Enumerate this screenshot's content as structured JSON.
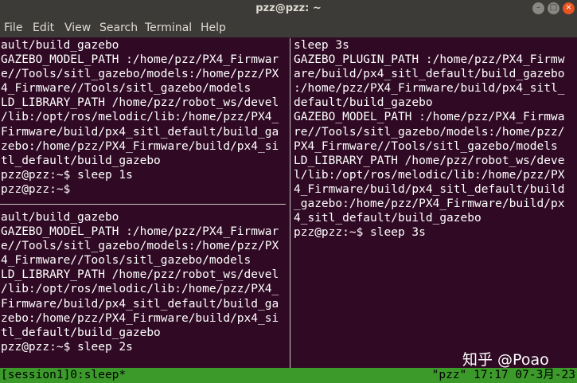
{
  "window": {
    "title": "pzz@pzz: ~"
  },
  "menu": [
    "File",
    "Edit",
    "View",
    "Search",
    "Terminal",
    "Help"
  ],
  "panes": {
    "left_top": [
      "ault/build_gazebo",
      "GAZEBO_MODEL_PATH :/home/pzz/PX4_Firmwar",
      "e//Tools/sitl_gazebo/models:/home/pzz/PX",
      "4_Firmware//Tools/sitl_gazebo/models",
      "LD_LIBRARY_PATH /home/pzz/robot_ws/devel",
      "/lib:/opt/ros/melodic/lib:/home/pzz/PX4_",
      "Firmware/build/px4_sitl_default/build_ga",
      "zebo:/home/pzz/PX4_Firmware/build/px4_si",
      "tl_default/build_gazebo",
      "pzz@pzz:~$ sleep 1s",
      "pzz@pzz:~$"
    ],
    "left_bottom": [
      "ault/build_gazebo",
      "GAZEBO_MODEL_PATH :/home/pzz/PX4_Firmwar",
      "e//Tools/sitl_gazebo/models:/home/pzz/PX",
      "4_Firmware//Tools/sitl_gazebo/models",
      "LD_LIBRARY_PATH /home/pzz/robot_ws/devel",
      "/lib:/opt/ros/melodic/lib:/home/pzz/PX4_",
      "Firmware/build/px4_sitl_default/build_ga",
      "zebo:/home/pzz/PX4_Firmware/build/px4_si",
      "tl_default/build_gazebo",
      "pzz@pzz:~$ sleep 2s"
    ],
    "right": [
      "sleep 3s",
      "GAZEBO_PLUGIN_PATH :/home/pzz/PX4_Firmw",
      "are/build/px4_sitl_default/build_gazebo",
      ":/home/pzz/PX4_Firmware/build/px4_sitl_",
      "default/build_gazebo",
      "GAZEBO_MODEL_PATH :/home/pzz/PX4_Firmwa",
      "re//Tools/sitl_gazebo/models:/home/pzz/",
      "PX4_Firmware//Tools/sitl_gazebo/models",
      "LD_LIBRARY_PATH /home/pzz/robot_ws/deve",
      "l/lib:/opt/ros/melodic/lib:/home/pzz/PX",
      "4_Firmware/build/px4_sitl_default/build",
      "_gazebo:/home/pzz/PX4_Firmware/build/px",
      "4_sitl_default/build_gazebo",
      "pzz@pzz:~$ sleep 3s"
    ]
  },
  "watermark": "知乎 @Poao",
  "status": {
    "left": "[session1]0:sleep*",
    "right": "\"pzz\" 17:17 07-3月-23"
  },
  "colors": {
    "terminal_bg": "#300a24",
    "status_bg": "#3c9a2b",
    "titlebar_bg": "#3c3b37",
    "close_button": "#e95420"
  },
  "icons": [
    "minimize-icon",
    "maximize-icon",
    "close-icon"
  ]
}
